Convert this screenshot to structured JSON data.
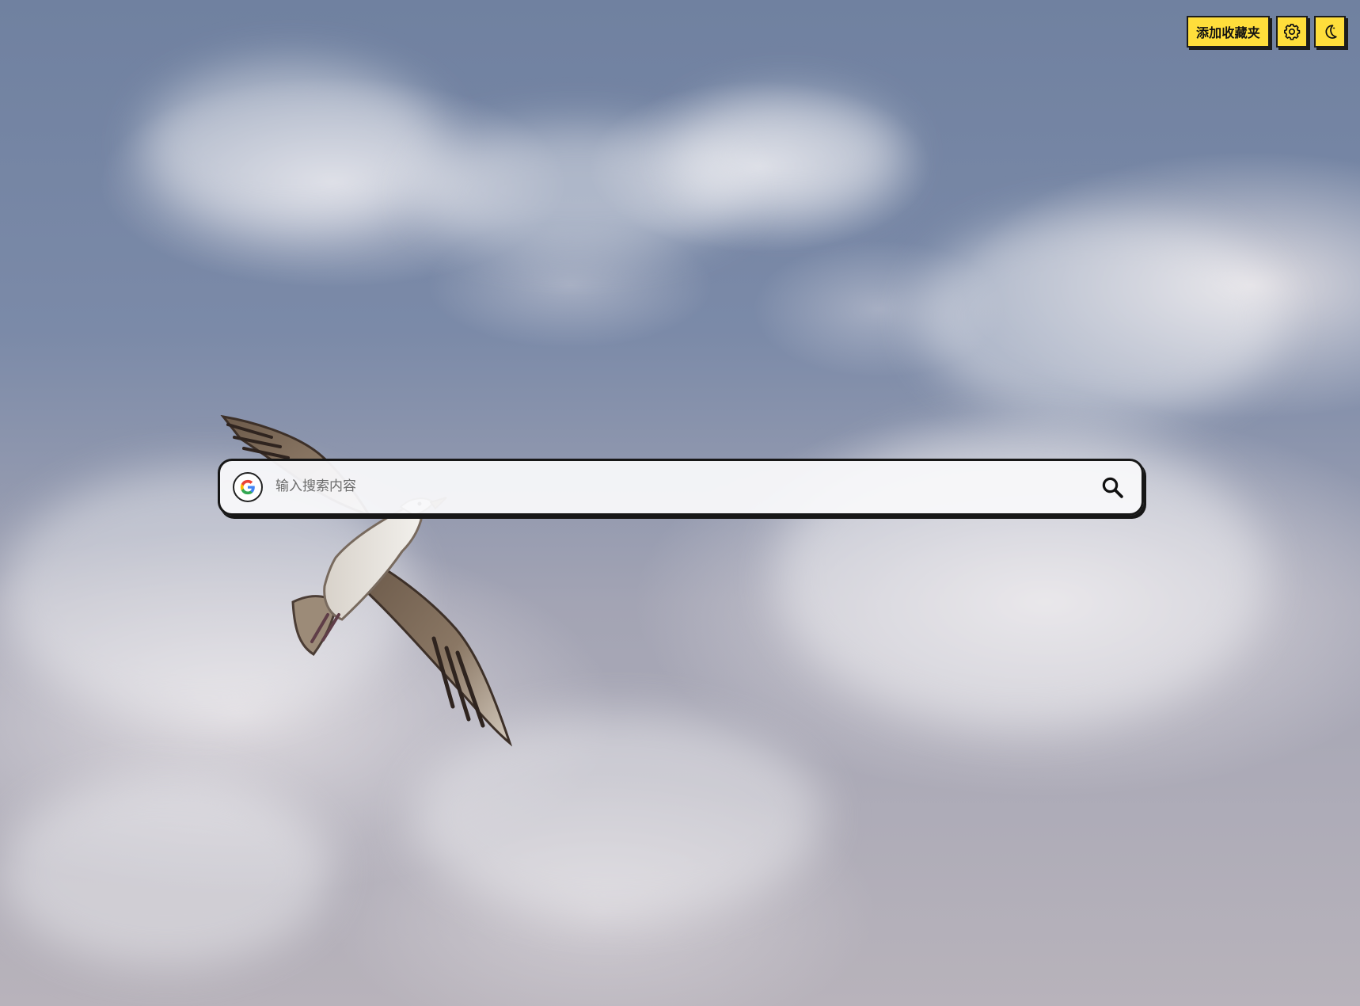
{
  "header": {
    "add_bookmark_label": "添加收藏夹",
    "settings_icon": "gear-icon",
    "theme_icon": "moon-icon"
  },
  "search": {
    "engine_icon": "google-g-icon",
    "placeholder": "输入搜索内容",
    "submit_icon": "search-icon"
  },
  "background": {
    "subject": "seagull-in-cloudy-sky"
  },
  "colors": {
    "accent": "#ffde3b",
    "border": "#1c1c1c",
    "search_bg": "#f8f8fa"
  }
}
